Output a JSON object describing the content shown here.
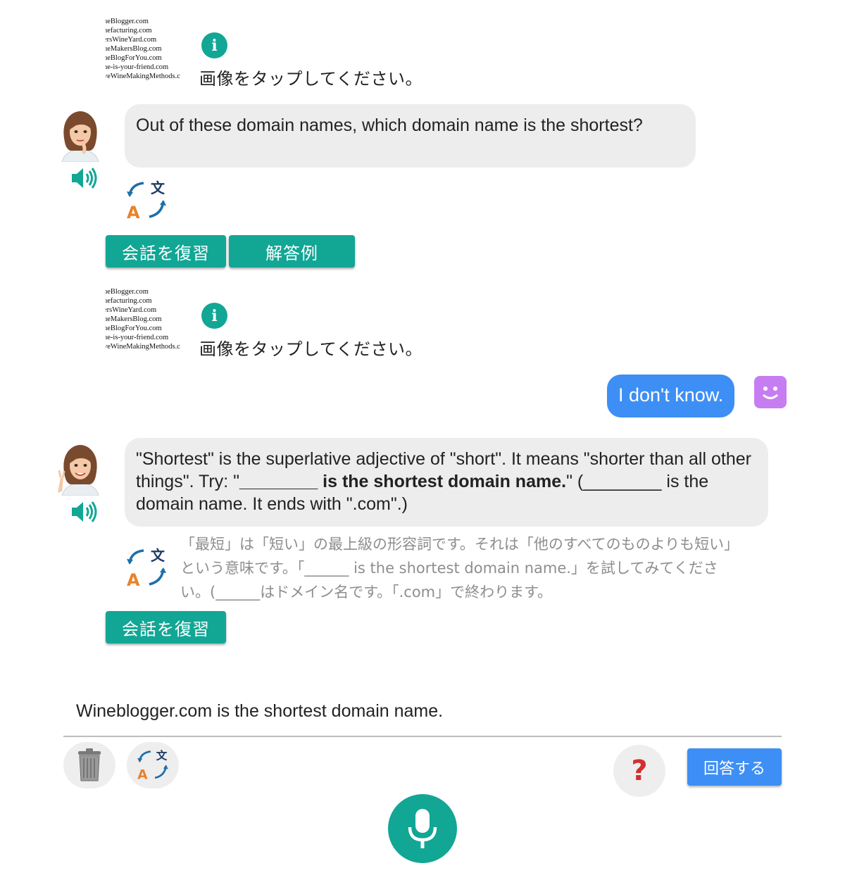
{
  "image_card": {
    "lines": [
      "neBlogger.com",
      "nefacturing.com",
      "ersWineYard.com",
      "neMakersBlog.com",
      "neBlogForYou.com",
      "ne-is-your-friend.com",
      "veWineMakingMethods.c"
    ],
    "tap_hint": "画像をタップしてください。"
  },
  "messages": {
    "bot1": "Out of these domain names, which domain name is the shortest?",
    "user1": "I don't know.",
    "bot2_part1": "\"Shortest\" is the superlative adjective of \"short\". It means \"shorter than all other things\". Try: \"",
    "bot2_blank": "________",
    "bot2_bold": " is the shortest domain name.",
    "bot2_part2": "\" (________ is the domain name. It ends with \".com\".)",
    "bot2_translation": "「最短」は「短い」の最上級の形容詞です。それは「他のすべてのものよりも短い」という意味です。「______ is the shortest domain name.」を試してみてください。(______はドメイン名です。「.com」で終わります。"
  },
  "buttons": {
    "review": "会話を復習",
    "sample_answer": "解答例",
    "submit": "回答する",
    "help": "?"
  },
  "input": {
    "answer": "Wineblogger.com is the shortest domain name."
  },
  "colors": {
    "teal": "#12a695",
    "blue": "#3d8ff5",
    "bubble_gray": "#ededed",
    "smiley_purple": "#c77df2"
  }
}
